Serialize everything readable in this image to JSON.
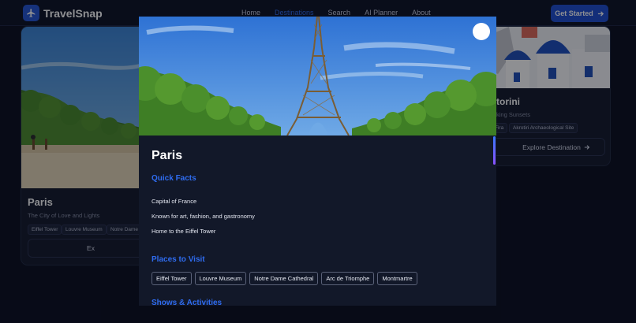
{
  "app": {
    "name": "TravelSnap",
    "nav": [
      "Home",
      "Destinations",
      "Search",
      "AI Planner",
      "About"
    ],
    "active_nav": "Destinations",
    "cta_label": "Get Started"
  },
  "cards": {
    "left": {
      "title": "Paris",
      "subtitle": "The City of Love and Lights",
      "tags": [
        "Eiffel Tower",
        "Louvre Museum",
        "Notre Dame C"
      ],
      "button": "Ex"
    },
    "right": {
      "title": "torini",
      "subtitle": "king Sunsets",
      "tags": [
        "Fira",
        "Akrotiri Archaeological Site"
      ],
      "button": "Explore Destination"
    }
  },
  "modal": {
    "title": "Paris",
    "quick_facts_heading": "Quick Facts",
    "facts": [
      "Capital of France",
      "Known for art, fashion, and gastronomy",
      "Home to the Eiffel Tower"
    ],
    "places_heading": "Places to Visit",
    "places": [
      "Eiffel Tower",
      "Louvre Museum",
      "Notre Dame Cathedral",
      "Arc de Triomphe",
      "Montmartre"
    ],
    "shows_heading": "Shows & Activities"
  },
  "colors": {
    "accent": "#2f6cf0",
    "cta": "#1f4fd1",
    "background": "#0b1020",
    "modal": "#121829"
  },
  "icons": {
    "logo": "airplane-icon",
    "cta": "arrow-right-icon",
    "close": "close-icon"
  }
}
